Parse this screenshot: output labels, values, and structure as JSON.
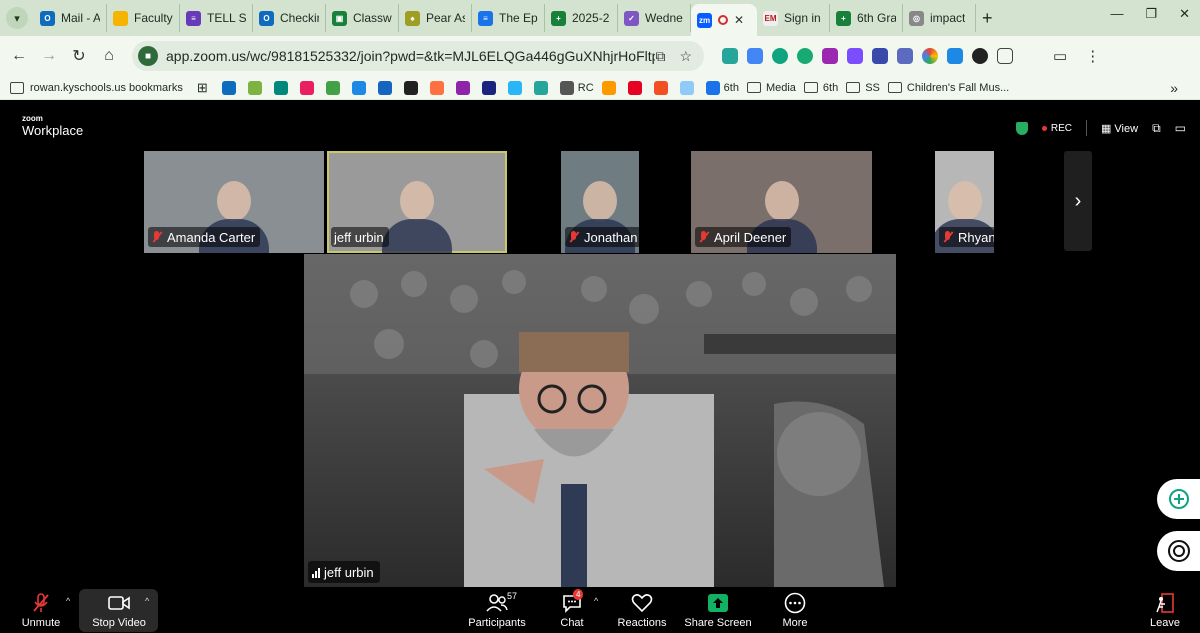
{
  "browser": {
    "tabs": [
      {
        "label": "Mail - A",
        "color": "#0f6cbd",
        "glyph": "O"
      },
      {
        "label": "Faculty",
        "color": "#f4b400",
        "glyph": ""
      },
      {
        "label": "TELL Su",
        "color": "#673ab7",
        "glyph": "≡"
      },
      {
        "label": "Checkin",
        "color": "#0f6cbd",
        "glyph": "O"
      },
      {
        "label": "Classw",
        "color": "#188038",
        "glyph": "▣"
      },
      {
        "label": "Pear As",
        "color": "#9e9d24",
        "glyph": "♠"
      },
      {
        "label": "The Epi",
        "color": "#1a73e8",
        "glyph": "≡"
      },
      {
        "label": "2025-2",
        "color": "#188038",
        "glyph": "+"
      },
      {
        "label": "Wedne",
        "color": "#7e57c2",
        "glyph": "✓"
      },
      {
        "label": "",
        "color": "#0b5cff",
        "glyph": "zm",
        "active": true
      },
      {
        "label": "Sign in",
        "color": "#eeeeee",
        "glyph": "EM"
      },
      {
        "label": "6th Gra",
        "color": "#188038",
        "glyph": "+"
      },
      {
        "label": "impact",
        "color": "#888888",
        "glyph": "◎"
      }
    ],
    "url": "app.zoom.us/wc/98181525332/join?pwd=&tk=MJL6ELQGa446gGuXNhjrHoFltpWA...",
    "bookmarks": [
      {
        "label": "rowan.kyschools.us bookmarks",
        "type": "page"
      },
      {
        "label": "",
        "type": "apps"
      },
      {
        "label": "",
        "type": "icon",
        "color": "#0f6cbd"
      },
      {
        "label": "",
        "type": "icon",
        "color": "#7cb342"
      },
      {
        "label": "",
        "type": "icon",
        "color": "#00897b"
      },
      {
        "label": "",
        "type": "icon",
        "color": "#e91e63"
      },
      {
        "label": "",
        "type": "icon",
        "color": "#43a047"
      },
      {
        "label": "",
        "type": "icon",
        "color": "#1e88e5"
      },
      {
        "label": "",
        "type": "icon",
        "color": "#1565c0"
      },
      {
        "label": "",
        "type": "icon",
        "color": "#212121"
      },
      {
        "label": "",
        "type": "icon",
        "color": "#ff7043"
      },
      {
        "label": "",
        "type": "icon",
        "color": "#8e24aa"
      },
      {
        "label": "",
        "type": "icon",
        "color": "#1a237e"
      },
      {
        "label": "",
        "type": "icon",
        "color": "#29b6f6"
      },
      {
        "label": "",
        "type": "icon",
        "color": "#26a69a"
      },
      {
        "label": "RC",
        "type": "icon",
        "color": "#555555"
      },
      {
        "label": "",
        "type": "icon",
        "color": "#ff9900"
      },
      {
        "label": "",
        "type": "icon",
        "color": "#e60023"
      },
      {
        "label": "",
        "type": "icon",
        "color": "#f25022"
      },
      {
        "label": "",
        "type": "icon",
        "color": "#90caf9"
      },
      {
        "label": "6th",
        "type": "icon",
        "color": "#1a73e8"
      },
      {
        "label": "Media",
        "type": "folder"
      },
      {
        "label": "6th",
        "type": "folder"
      },
      {
        "label": "SS",
        "type": "folder"
      },
      {
        "label": "Children's Fall Mus...",
        "type": "folder"
      }
    ]
  },
  "zoom": {
    "logo_small": "zoom",
    "logo_big": "Workplace",
    "rec_label": "REC",
    "view_label": "View",
    "participants_tiles": [
      {
        "name": "Amanda Carter",
        "muted": true,
        "bg": "#8a8f94"
      },
      {
        "name": "jeff urbin",
        "muted": false,
        "bg": "#9a9a9a",
        "speaking": true
      },
      {
        "name": "Jonathan Greer",
        "muted": true,
        "bg": "#6f7c82"
      },
      {
        "name": "April Deener",
        "muted": true,
        "bg": "#7a6f6a"
      },
      {
        "name": "Rhyana Welch",
        "muted": true,
        "bg": "#b7b7b7"
      }
    ],
    "main_speaker": "jeff urbin",
    "toolbar": {
      "unmute": "Unmute",
      "stop_video": "Stop Video",
      "participants": "Participants",
      "participants_count": "57",
      "chat": "Chat",
      "chat_badge": "4",
      "reactions": "Reactions",
      "share_screen": "Share Screen",
      "more": "More",
      "leave": "Leave"
    }
  },
  "colors": {
    "share_green": "#12b264",
    "leave_red": "#e53935",
    "mute_red": "#e53935"
  }
}
